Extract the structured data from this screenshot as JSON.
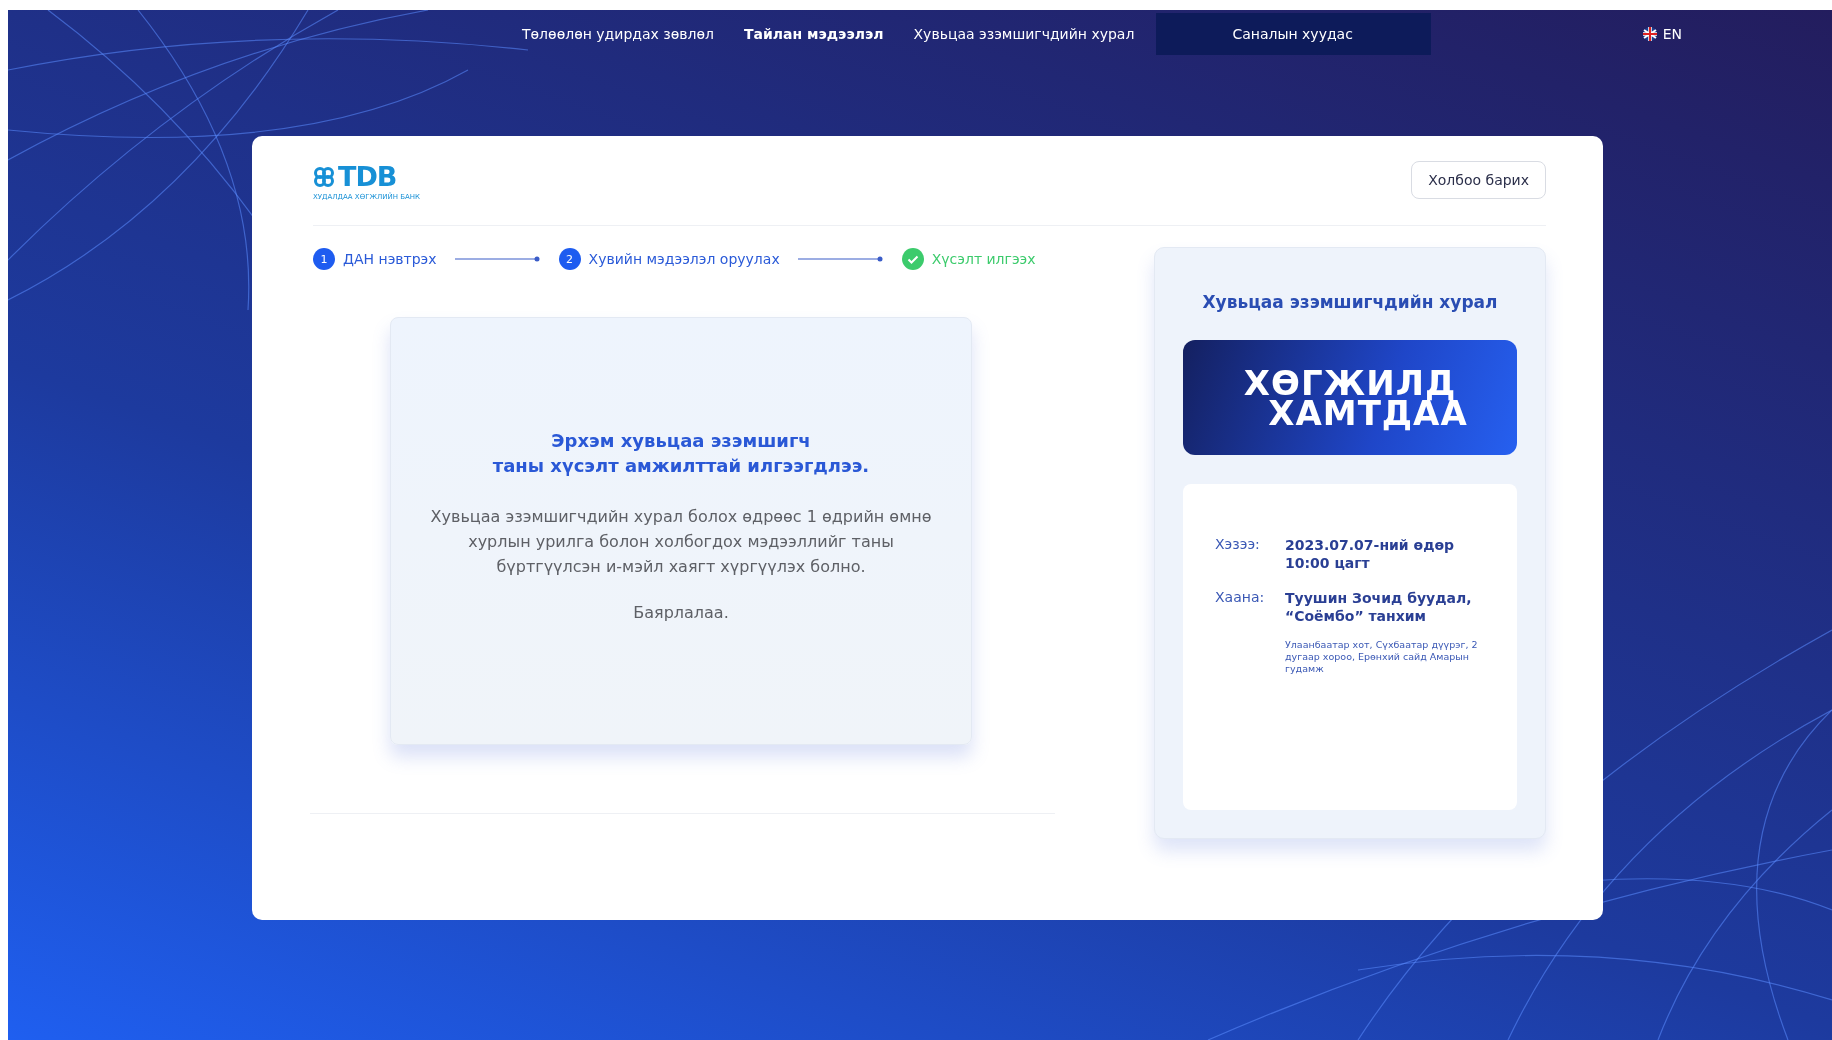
{
  "nav": {
    "items": [
      {
        "label": "Төлөөлөн удирдах зөвлөл",
        "selected": false,
        "emphasized": false
      },
      {
        "label": "Тайлан мэдээлэл",
        "selected": false,
        "emphasized": true
      },
      {
        "label": "Хувьцаа эзэмшигчдийн хурал",
        "selected": false,
        "emphasized": false
      },
      {
        "label": "Саналын хуудас",
        "selected": true,
        "emphasized": false
      }
    ],
    "language": "EN"
  },
  "card": {
    "logo": {
      "name": "TDB",
      "subtitle": "ХУДАЛДАА ХӨГЖЛИЙН БАНК"
    },
    "contact_button": "Холбоо барих",
    "steps": [
      {
        "number": "1",
        "label": "ДАН нэвтрэх",
        "kind": "numbered"
      },
      {
        "number": "2",
        "label": "Хувийн мэдээлэл оруулах",
        "kind": "numbered"
      },
      {
        "label": "Хүсэлт илгээх",
        "kind": "done"
      }
    ],
    "success": {
      "title_lines": [
        "Эрхэм хувьцаа эзэмшигч",
        "таны хүсэлт амжилттай илгээгдлээ."
      ],
      "message": "Хувьцаа эзэмшигчдийн хурал болох өдрөөс 1 өдрийн өмнө хурлын урилга болон холбогдох мэдээллийг таны бүртгүүлсэн и-мэйл хаягт хүргүүлэх болно.",
      "thanks": "Баярлалаа."
    }
  },
  "meeting": {
    "title": "Хувьцаа эзэмшигчдийн хурал",
    "banner": [
      "ХӨГЖИЛД",
      "ХАМТДАА"
    ],
    "details": [
      {
        "label": "Хэзээ:",
        "value_lines": [
          "2023.07.07-ний өдөр",
          "10:00 цагт"
        ]
      },
      {
        "label": "Хаана:",
        "value_lines": [
          "Туушин Зочид буудал,",
          "“Соёмбо” танхим"
        ],
        "note": "Улаанбаатар хот, Сүхбаатар дүүрэг, 2 дугаар хороо, Ерөнхий сайд Амарын гудамж"
      }
    ]
  }
}
